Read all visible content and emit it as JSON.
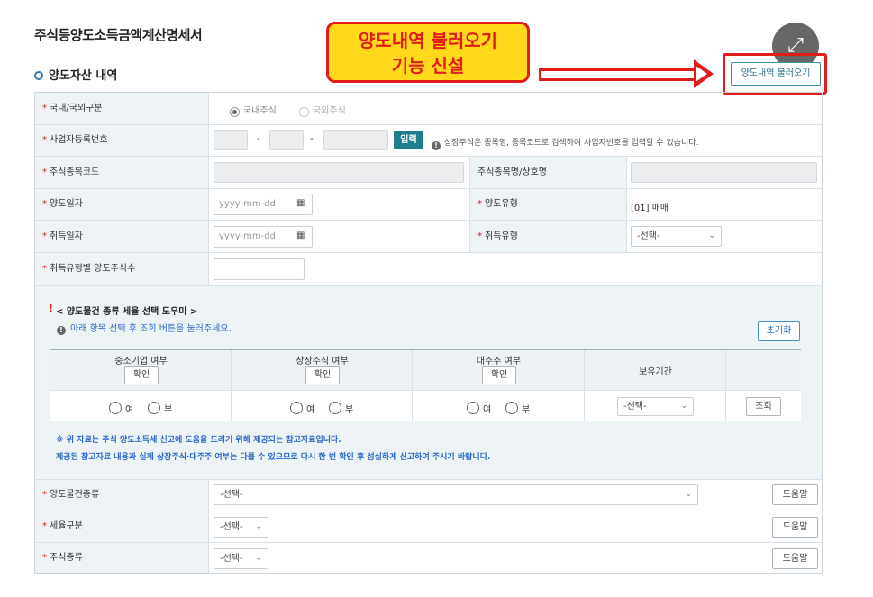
{
  "page_title": "주식등양도소득금액계산명세서",
  "section_title": "양도자산 내역",
  "callout": {
    "line1": "양도내역 불러오기",
    "line2": "기능 신설"
  },
  "load_button": "양도내역 불러오기",
  "zoom_icon": "expand-icon",
  "rows": {
    "domestic": {
      "label": "국내/국외구분",
      "opt1": "국내주식",
      "opt2": "국외주식"
    },
    "bizno": {
      "label": "사업자등록번호",
      "sep": "-",
      "enter_btn": "입력",
      "help": "상장주식은 종목명, 종목코드로 검색하여 사업자번호를 입력할 수 있습니다."
    },
    "stockcode": {
      "label": "주식종목코드",
      "label2": "주식종목명/상호명"
    },
    "transfer_date": {
      "label": "양도일자",
      "placeholder": "yyyy-mm-dd",
      "label2": "양도유형",
      "value2": "[01] 매매"
    },
    "acquire_date": {
      "label": "취득일자",
      "placeholder": "yyyy-mm-dd",
      "label2": "취득유형",
      "select2": "-선택-"
    },
    "qty": {
      "label": "취득유형별 양도주식수"
    }
  },
  "helper": {
    "title": "< 양도물건 종류 세율 선택 도우미 >",
    "mark": "!",
    "hint": "아래 항목 선택 후 조회 버튼을 눌러주세요.",
    "reset_btn": "초기화",
    "cols": [
      {
        "title": "중소기업 여부",
        "btn": "확인"
      },
      {
        "title": "상장주식 여부",
        "btn": "확인"
      },
      {
        "title": "대주주 여부",
        "btn": "확인"
      },
      {
        "title": "보유기간"
      }
    ],
    "yes": "여",
    "no": "부",
    "period_select": "-선택-",
    "query_btn": "조회",
    "note1": "※ 위 자료는 주식 양도소득세 신고에 도움을 드리기 위해 제공되는 참고자료입니다.",
    "note2": "제공된 참고자료 내용과 실제 상장주식·대주주 여부는 다를 수 있으므로 다시 한 번 확인 후 성실하게 신고하여 주시기 바랍니다."
  },
  "bottom_rows": [
    {
      "label": "양도물건종류",
      "select": "-선택-",
      "help_btn": "도움말"
    },
    {
      "label": "세율구분",
      "select": "-선택-",
      "help_btn": "도움말"
    },
    {
      "label": "주식종류",
      "select": "-선택-",
      "help_btn": "도움말"
    }
  ],
  "required_mark": "*",
  "colors": {
    "accent": "#1f7e8c",
    "callout_bg": "#ffd91a",
    "callout_border": "#e21b1b"
  }
}
